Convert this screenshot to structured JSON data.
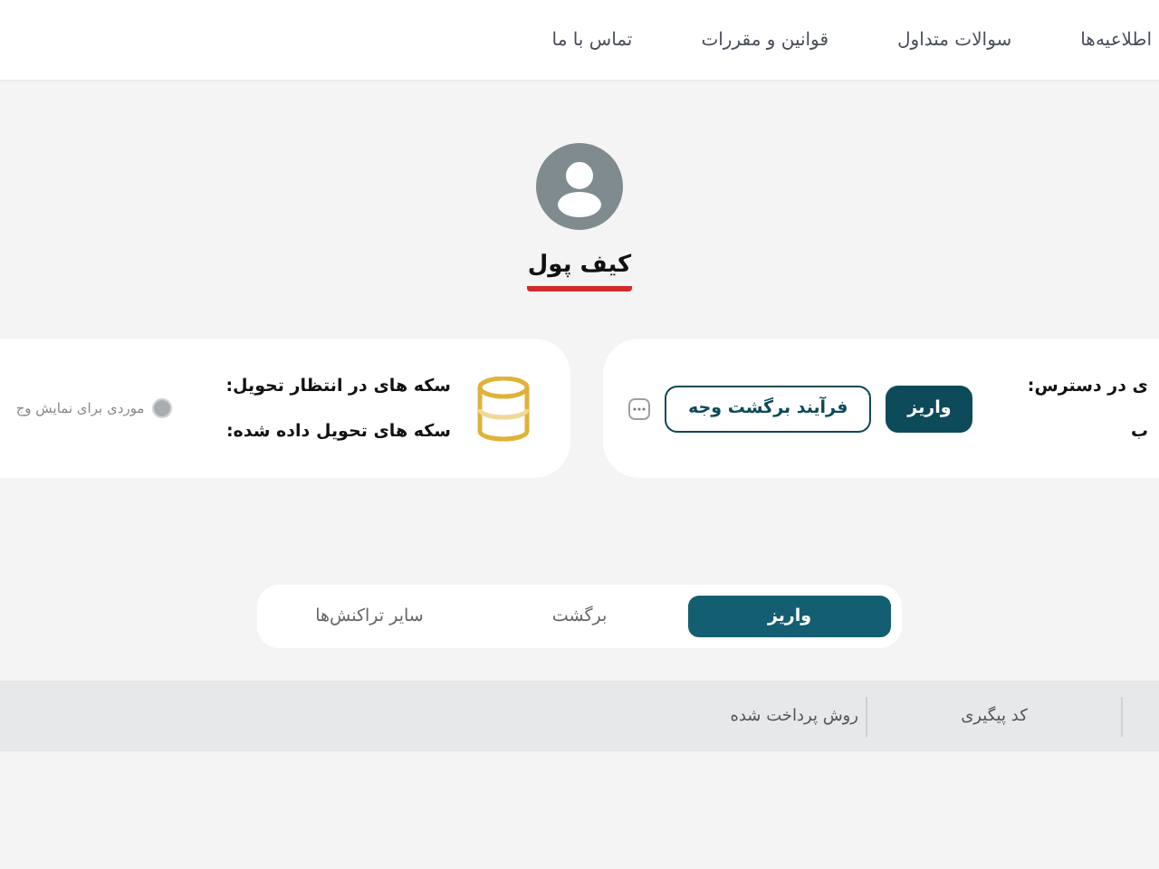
{
  "nav": {
    "links": [
      "اطلاعیه‌ها",
      "سوالات متداول",
      "قوانین و مقررات",
      "تماس با ما"
    ]
  },
  "page_title": "کیف پول",
  "balance_card": {
    "label": "ی در دسترس:",
    "value": "ب",
    "buttons": [
      {
        "label": "واریز",
        "kind": "primary"
      },
      {
        "label": "فرآیند برگشت وجه",
        "kind": "outline"
      }
    ]
  },
  "coins_card": {
    "labels": [
      "سکه های در انتظار تحویل:",
      "سکه های تحویل داده شده:"
    ],
    "empty_message": "موردی برای نمایش وج"
  },
  "tabs": [
    {
      "label": "واریز",
      "selected": true
    },
    {
      "label": "برگشت",
      "selected": false
    },
    {
      "label": "سایر تراکنش‌ها",
      "selected": false
    }
  ],
  "table": {
    "columns": [
      "",
      "کد پیگیری",
      "روش پرداخت شده"
    ]
  }
}
